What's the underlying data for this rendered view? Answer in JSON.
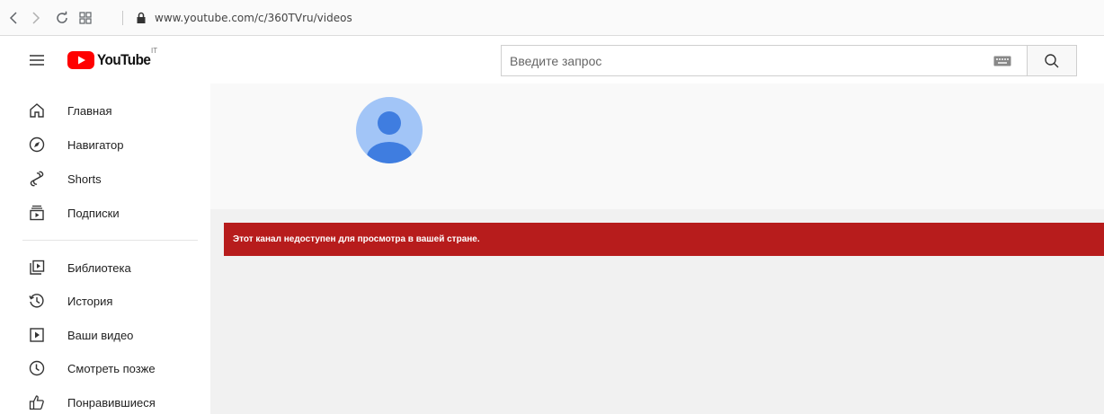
{
  "browser": {
    "url": "www.youtube.com/c/360TVru/videos"
  },
  "header": {
    "logo_text": "YouTube",
    "country_code": "IT",
    "search_placeholder": "Введите запрос"
  },
  "sidebar": {
    "items": [
      {
        "label": "Главная",
        "icon": "home-icon"
      },
      {
        "label": "Навигатор",
        "icon": "compass-icon"
      },
      {
        "label": "Shorts",
        "icon": "shorts-icon"
      },
      {
        "label": "Подписки",
        "icon": "subscriptions-icon"
      },
      {
        "label": "Библиотека",
        "icon": "library-icon"
      },
      {
        "label": "История",
        "icon": "history-icon"
      },
      {
        "label": "Ваши видео",
        "icon": "your-videos-icon"
      },
      {
        "label": "Смотреть позже",
        "icon": "watch-later-icon"
      },
      {
        "label": "Понравившиеся",
        "icon": "like-icon"
      }
    ]
  },
  "channel": {
    "alert_message": "Этот канал недоступен для просмотра в вашей стране."
  },
  "colors": {
    "alert_bg": "#b71c1c",
    "avatar_bg": "#a2c5f7",
    "avatar_fg": "#3f7de0",
    "brand_red": "#ff0000"
  }
}
